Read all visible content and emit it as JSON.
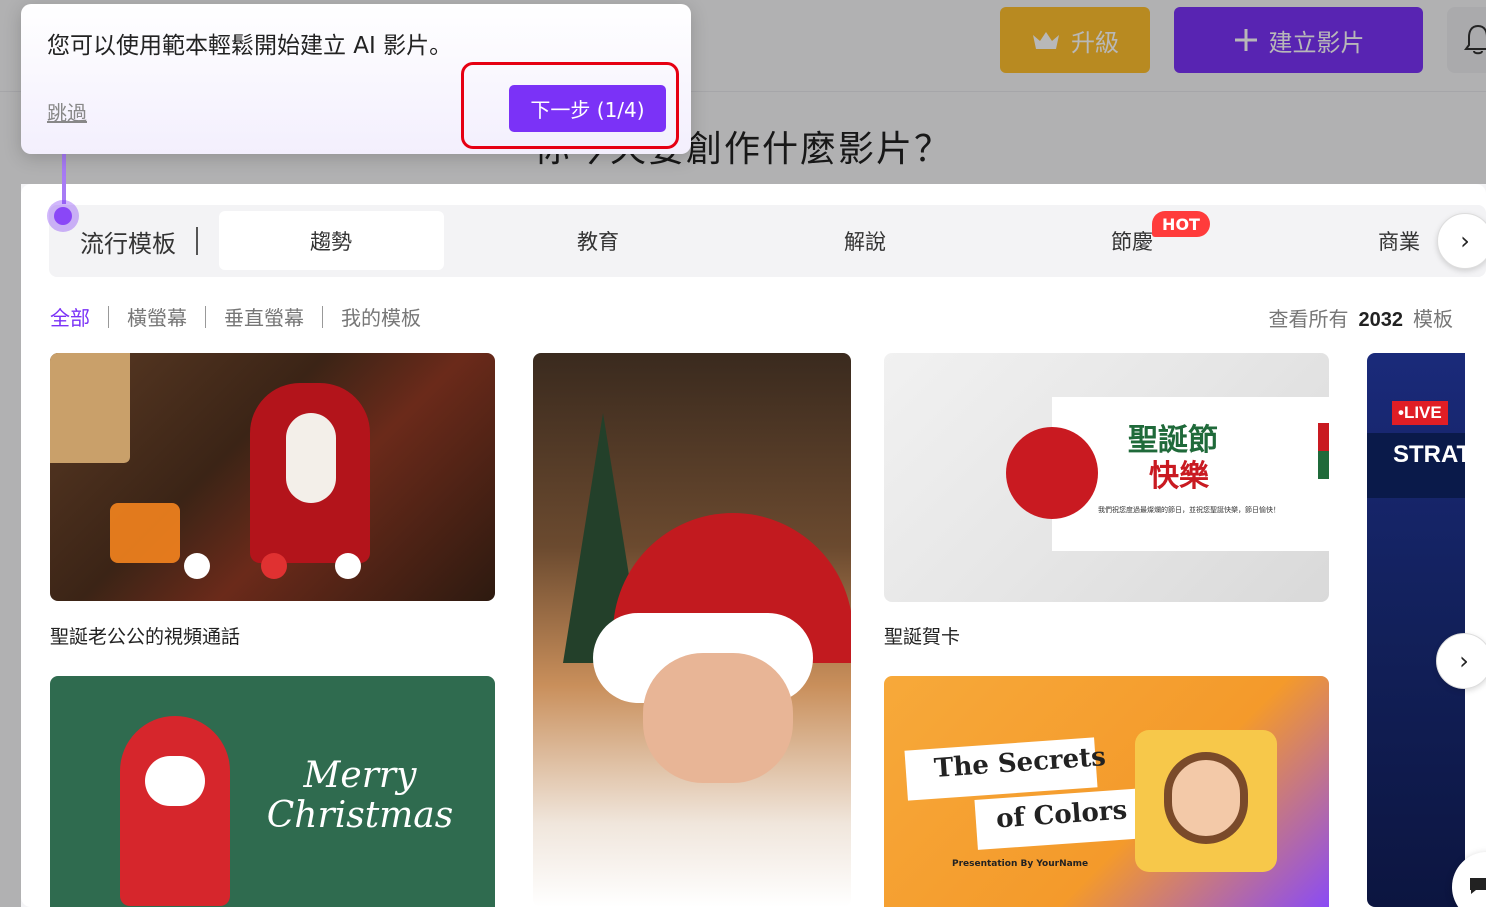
{
  "header": {
    "upgrade_label": "升級",
    "create_label": "建立影片",
    "hero_title": "你今天要創作什麼影片？"
  },
  "tabs": {
    "section_label": "流行模板",
    "items": [
      "趨勢",
      "教育",
      "解說",
      "節慶",
      "商業"
    ],
    "active": "趨勢",
    "hot_badge": "HOT"
  },
  "filters": {
    "items": [
      "全部",
      "橫螢幕",
      "垂直螢幕",
      "我的模板"
    ],
    "active": "全部",
    "view_all_prefix": "查看所有",
    "view_all_count": "2032",
    "view_all_suffix": "模板"
  },
  "cards": {
    "santa_call": {
      "title": "聖誕老公公的視頻通話"
    },
    "greeting": {
      "title": "聖誕賀卡",
      "image_heading_1": "聖誕節",
      "image_heading_2": "快樂",
      "image_caption": "我們祝您度過最燦爛的節日，並祝您聖誕快樂，節日愉快！"
    },
    "xmas": {
      "image_text": "Merry Christmas"
    },
    "colors": {
      "image_line1": "The Secrets",
      "image_line2": "of Colors",
      "image_credit": "Presentation By YourName"
    },
    "live": {
      "badge": "•LIVE",
      "text": "STRATE"
    }
  },
  "tour": {
    "message": "您可以使用範本輕鬆開始建立 AI 影片。",
    "skip_label": "跳過",
    "next_label": "下一步 (1/4)"
  },
  "colors": {
    "accent": "#7b32f7",
    "upgrade": "#ffbf2e",
    "hot": "#ff3b3b",
    "highlight_outline": "#e60012"
  },
  "icons": {
    "upgrade": "crown-icon",
    "create": "plus-icon",
    "bell": "bell-icon",
    "next": "chevron-right-icon",
    "chat": "chat-icon"
  }
}
